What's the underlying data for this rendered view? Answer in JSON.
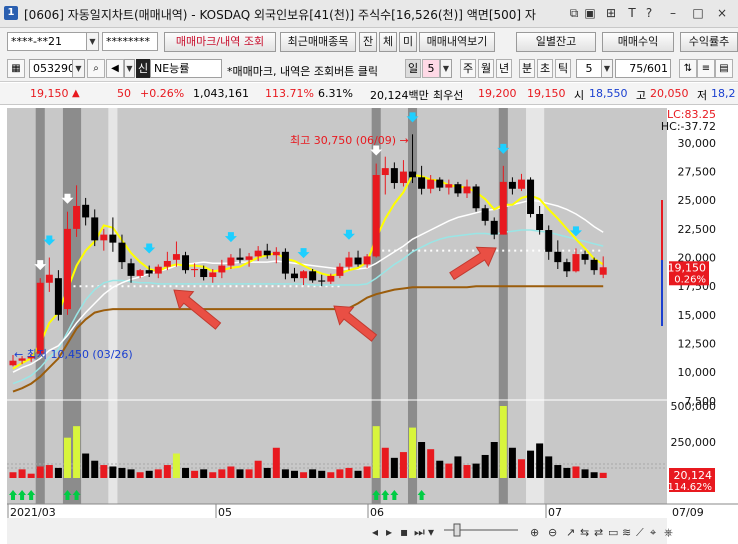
{
  "window": {
    "badge": "1",
    "title": "[0606] 자동일지차트(매매내역) - KOSDAQ 외국인보유[41(천)] 주식수[16,526(천)] 액면[500] 자"
  },
  "account": {
    "number": "****-**21",
    "password": "********",
    "btn_trade_marks": "매매마크/내역 조회",
    "btn_recent_items": "최근매매종목",
    "btn_balance": "잔",
    "btn_exec": "체",
    "btn_unexec": "미",
    "btn_history": "매매내역보기",
    "btn_daily_balance": "일별잔고",
    "btn_trade_profit": "매매수익",
    "btn_yield": "수익률추"
  },
  "stock": {
    "code": "053290",
    "market_badge": "신",
    "name": "NE능률",
    "hint": "*매매마크, 내역은 조회버튼 클릭",
    "period_label": "일",
    "period_value": "5",
    "periods": [
      "주",
      "월",
      "년",
      "분",
      "초",
      "틱"
    ],
    "tick_value": "5",
    "count_value": "75/601"
  },
  "quote": {
    "price": "19,150",
    "arrow": "▲",
    "change": "50",
    "change_pct": "+0.26%",
    "volume": "1,043,161",
    "vol_ratio": "113.71%",
    "turnover": "6.31%",
    "amount": "20,124백만",
    "pref_label": "최우선",
    "best_ask": "19,200",
    "best_bid": "19,150",
    "open_label": "시",
    "open": "18,550",
    "high_label": "고",
    "high": "20,050",
    "low_label": "저",
    "low": "18,2"
  },
  "chart_data": {
    "type": "candlestick",
    "annotations": {
      "lc": "LC:83.25",
      "hc": "HC:-37.72",
      "high_note": "최고 30,750 (06/09)",
      "low_note": "최저 10,450 (03/26)",
      "last_price": "19,150",
      "last_change": "0.26%",
      "last_volume": "20,124",
      "last_volume_pct": "114.62%"
    },
    "price_axis": [
      "30,000",
      "27,500",
      "25,000",
      "22,500",
      "20,000",
      "17,500",
      "15,000",
      "12,500",
      "10,000",
      "7,500"
    ],
    "volume_axis": [
      "500,000",
      "250,000"
    ],
    "x_labels": [
      "2021/03",
      "05",
      "06",
      "07",
      "07/09"
    ],
    "colors": {
      "up": "#e8191f",
      "down": "#000000",
      "ma5": "#ffff00",
      "ma20": "#ffffff",
      "ma60": "#99e6e6",
      "ma120": "#9b5d0c",
      "vol_highlight": "#d8f53c",
      "buy_marker": "#00cc44",
      "sell_marker": "#1ecfff"
    },
    "candles": [
      [
        10.6,
        11.5,
        10.5,
        11.0
      ],
      [
        11.0,
        11.4,
        10.7,
        11.2
      ],
      [
        11.2,
        11.6,
        10.9,
        11.4
      ],
      [
        11.6,
        18.2,
        11.5,
        17.8
      ],
      [
        17.8,
        20.0,
        17.0,
        18.5
      ],
      [
        18.2,
        18.9,
        14.5,
        15.0
      ],
      [
        15.5,
        24.0,
        15.0,
        22.5
      ],
      [
        22.5,
        26.3,
        21.8,
        24.5
      ],
      [
        24.6,
        25.2,
        22.8,
        23.5
      ],
      [
        23.5,
        24.2,
        21.0,
        21.5
      ],
      [
        21.5,
        22.5,
        20.6,
        22.0
      ],
      [
        22.0,
        23.5,
        20.5,
        21.3
      ],
      [
        21.3,
        22.0,
        19.0,
        19.6
      ],
      [
        19.5,
        19.9,
        17.8,
        18.4
      ],
      [
        18.4,
        19.0,
        18.2,
        18.9
      ],
      [
        18.9,
        19.3,
        18.3,
        18.6
      ],
      [
        18.6,
        19.4,
        18.2,
        19.2
      ],
      [
        19.2,
        20.5,
        18.9,
        19.7
      ],
      [
        19.8,
        21.4,
        19.2,
        20.3
      ],
      [
        20.2,
        20.5,
        18.6,
        18.9
      ],
      [
        18.9,
        19.5,
        18.3,
        19.0
      ],
      [
        19.0,
        19.3,
        18.0,
        18.3
      ],
      [
        18.3,
        19.0,
        17.8,
        18.7
      ],
      [
        18.7,
        19.8,
        18.2,
        19.3
      ],
      [
        19.3,
        20.3,
        19.0,
        20.0
      ],
      [
        20.0,
        20.8,
        19.5,
        19.8
      ],
      [
        19.8,
        20.4,
        19.2,
        20.1
      ],
      [
        20.1,
        21.0,
        19.7,
        20.6
      ],
      [
        20.6,
        21.2,
        19.9,
        20.2
      ],
      [
        20.2,
        20.9,
        19.5,
        20.5
      ],
      [
        20.5,
        20.8,
        18.1,
        18.6
      ],
      [
        18.6,
        19.1,
        17.9,
        18.2
      ],
      [
        18.2,
        18.9,
        17.6,
        18.8
      ],
      [
        18.8,
        19.0,
        17.8,
        18.0
      ],
      [
        18.0,
        18.5,
        17.5,
        17.9
      ],
      [
        17.9,
        18.6,
        17.7,
        18.4
      ],
      [
        18.4,
        19.5,
        18.2,
        19.2
      ],
      [
        19.2,
        20.5,
        18.9,
        20.0
      ],
      [
        20.0,
        20.6,
        19.2,
        19.4
      ],
      [
        19.4,
        20.3,
        19.1,
        20.1
      ],
      [
        20.1,
        28.2,
        20.0,
        27.2
      ],
      [
        27.2,
        28.8,
        25.5,
        27.8
      ],
      [
        27.8,
        28.3,
        26.0,
        26.5
      ],
      [
        26.5,
        28.5,
        26.2,
        27.5
      ],
      [
        27.5,
        30.75,
        26.5,
        27.0
      ],
      [
        27.0,
        28.0,
        25.5,
        26.0
      ],
      [
        26.0,
        27.2,
        25.6,
        26.8
      ],
      [
        26.8,
        27.0,
        25.8,
        26.1
      ],
      [
        26.1,
        26.8,
        25.5,
        26.4
      ],
      [
        26.4,
        26.6,
        25.3,
        25.6
      ],
      [
        25.6,
        26.8,
        25.2,
        26.2
      ],
      [
        26.2,
        26.4,
        24.0,
        24.3
      ],
      [
        24.3,
        24.6,
        22.8,
        23.2
      ],
      [
        23.2,
        23.5,
        21.6,
        22.0
      ],
      [
        22.0,
        28.0,
        22.0,
        26.6
      ],
      [
        26.6,
        27.0,
        25.5,
        26.0
      ],
      [
        26.0,
        27.3,
        25.8,
        26.8
      ],
      [
        26.8,
        27.0,
        23.5,
        23.8
      ],
      [
        23.8,
        24.5,
        22.0,
        22.4
      ],
      [
        22.4,
        22.8,
        19.8,
        20.5
      ],
      [
        20.5,
        21.5,
        19.0,
        19.6
      ],
      [
        19.6,
        19.9,
        18.3,
        18.8
      ],
      [
        18.8,
        20.8,
        18.7,
        20.3
      ],
      [
        20.3,
        20.6,
        19.4,
        19.8
      ],
      [
        19.8,
        20.0,
        18.5,
        18.9
      ],
      [
        18.5,
        20.1,
        18.2,
        19.15
      ]
    ],
    "volumes": [
      40,
      60,
      30,
      80,
      90,
      70,
      280,
      360,
      170,
      120,
      90,
      80,
      70,
      60,
      40,
      50,
      60,
      90,
      170,
      70,
      50,
      60,
      40,
      60,
      80,
      60,
      60,
      120,
      70,
      210,
      60,
      50,
      40,
      60,
      50,
      40,
      60,
      70,
      50,
      80,
      360,
      210,
      140,
      180,
      350,
      250,
      200,
      120,
      100,
      150,
      90,
      100,
      160,
      250,
      500,
      210,
      130,
      190,
      240,
      150,
      90,
      70,
      80,
      60,
      40,
      36
    ],
    "vol_highlight_index": [
      6,
      7,
      18,
      40,
      44,
      54
    ],
    "ma5": [
      10.3,
      10.8,
      11.2,
      12.5,
      14.3,
      15.2,
      17.2,
      19.3,
      20.6,
      21.4,
      22.8,
      22.6,
      21.5,
      20.4,
      19.6,
      19.0,
      18.8,
      19.2,
      19.4,
      19.3,
      19.3,
      19.2,
      18.8,
      18.9,
      19.1,
      19.2,
      19.6,
      20.0,
      20.2,
      20.4,
      19.9,
      19.7,
      19.3,
      18.9,
      18.6,
      18.4,
      18.6,
      18.9,
      19.1,
      19.6,
      21.7,
      23.4,
      24.7,
      25.7,
      27.2,
      27.1,
      26.8,
      26.7,
      26.3,
      26.2,
      26.1,
      25.7,
      25.1,
      24.2,
      24.6,
      24.6,
      25.2,
      25.4,
      25.1,
      24.2,
      23.4,
      22.5,
      21.6,
      20.8,
      19.9,
      19.4
    ],
    "ma20": [
      10.0,
      10.4,
      10.7,
      11.2,
      11.9,
      12.3,
      13.2,
      14.3,
      15.2,
      16.0,
      16.8,
      17.4,
      17.8,
      18.1,
      18.3,
      18.6,
      18.8,
      19.0,
      19.3,
      19.4,
      19.5,
      19.6,
      19.5,
      19.5,
      19.5,
      19.6,
      19.6,
      19.6,
      19.6,
      19.7,
      19.6,
      19.5,
      19.4,
      19.3,
      19.2,
      19.1,
      19.0,
      19.0,
      19.0,
      19.1,
      19.5,
      20.0,
      20.5,
      21.0,
      21.6,
      22.0,
      22.4,
      22.8,
      23.2,
      23.5,
      23.7,
      23.9,
      24.1,
      24.2,
      24.4,
      24.6,
      24.8,
      25.0,
      24.9,
      24.7,
      24.5,
      24.2,
      23.8,
      23.3,
      22.7,
      22.2
    ],
    "ma60": [
      9.0,
      9.3,
      9.7,
      10.4,
      11.3,
      12.0,
      13.5,
      15.0,
      16.3,
      17.2,
      17.8,
      18.0,
      18.0,
      17.9,
      17.8,
      17.8,
      17.7,
      17.7,
      17.7,
      17.7,
      17.7,
      17.7,
      17.7,
      17.7,
      17.7,
      17.7,
      17.7,
      17.7,
      17.7,
      17.7,
      17.7,
      17.7,
      17.7,
      17.6,
      17.6,
      17.6,
      17.6,
      17.6,
      17.6,
      17.7,
      18.2,
      18.8,
      19.4,
      19.9,
      20.5,
      20.9,
      21.3,
      21.6,
      21.8,
      21.9,
      22.0,
      22.1,
      22.1,
      22.0,
      22.2,
      22.3,
      22.4,
      22.4,
      22.3,
      22.2,
      22.0,
      21.8,
      21.6,
      21.4,
      21.2,
      21.0
    ],
    "ma120": [
      8.3,
      8.6,
      9.0,
      9.6,
      10.4,
      11.2,
      12.5,
      13.8,
      14.6,
      15.2,
      15.4,
      15.5,
      15.5,
      15.5,
      15.5,
      15.5,
      15.5,
      15.5,
      15.5,
      15.5,
      15.5,
      15.5,
      15.5,
      15.5,
      15.5,
      15.5,
      15.5,
      15.5,
      15.5,
      15.5,
      15.5,
      15.5,
      15.5,
      15.5,
      15.5,
      15.5,
      15.5,
      15.6,
      16.0,
      16.5,
      16.8,
      17.0,
      17.2,
      17.3,
      17.4,
      17.4,
      17.4,
      17.4,
      17.4,
      17.4,
      17.4,
      17.5,
      17.5,
      17.5,
      17.5,
      17.5,
      17.5,
      17.5,
      17.5,
      17.5,
      17.5,
      17.5,
      17.5,
      17.5,
      17.5,
      17.5
    ],
    "ref_lines": [
      {
        "from": 6,
        "to": 36,
        "value": 17.5
      },
      {
        "from": 40,
        "to": 65,
        "value": 20.6
      }
    ],
    "shaded_bands": [
      {
        "from": 3,
        "to": 3,
        "shade": "dark"
      },
      {
        "from": 6,
        "to": 7,
        "shade": "dark"
      },
      {
        "from": 11,
        "to": 11,
        "shade": "light"
      },
      {
        "from": 40,
        "to": 40,
        "shade": "dark"
      },
      {
        "from": 44,
        "to": 44,
        "shade": "dark"
      },
      {
        "from": 54,
        "to": 54,
        "shade": "dark"
      },
      {
        "from": 57,
        "to": 58,
        "shade": "light"
      }
    ],
    "sell_marks": [
      4,
      15,
      24,
      32,
      37,
      44,
      54,
      62
    ],
    "buy_marks_white": [
      3,
      6,
      40
    ],
    "green_arrows": [
      0,
      1,
      2,
      6,
      7,
      40,
      41,
      42,
      45
    ]
  }
}
